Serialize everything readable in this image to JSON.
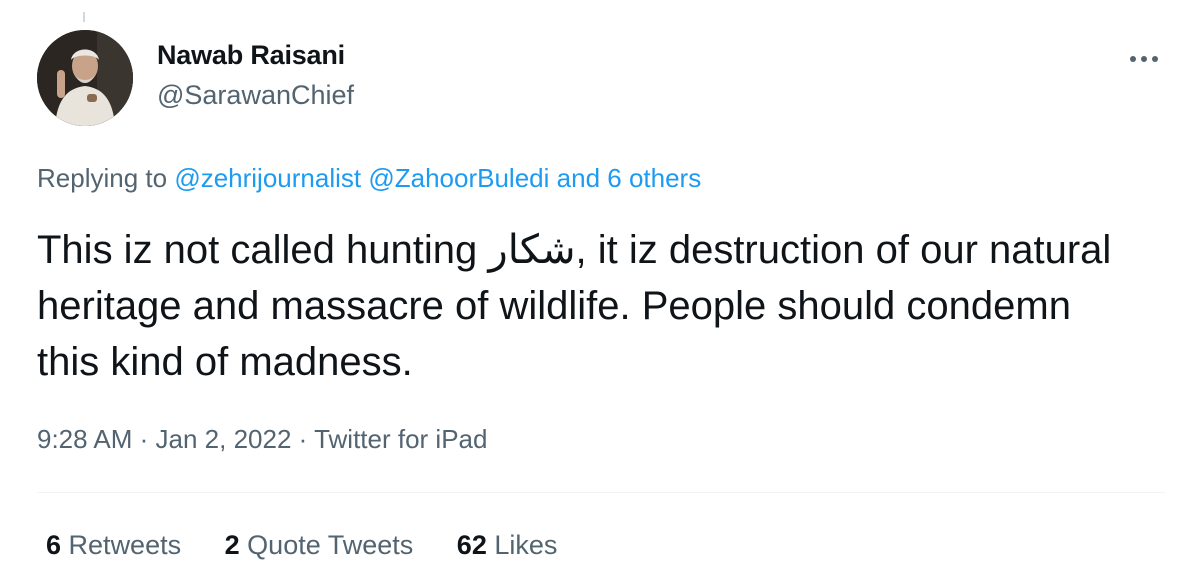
{
  "author": {
    "display_name": "Nawab Raisani",
    "handle": "@SarawanChief"
  },
  "reply": {
    "prefix": "Replying to",
    "mentions": [
      "@zehrijournalist",
      "@ZahoorBuledi"
    ],
    "others": "and 6 others"
  },
  "tweet": {
    "text_part1": "This iz not called hunting ",
    "urdu_word": "شکار",
    "text_part2": ", it iz destruction of our natural heritage and massacre of wildlife. People should condemn this kind of madness."
  },
  "meta": {
    "time": "9:28 AM",
    "date": "Jan 2, 2022",
    "source": "Twitter for iPad"
  },
  "stats": {
    "retweets_count": "6",
    "retweets_label": "Retweets",
    "quotes_count": "2",
    "quotes_label": "Quote Tweets",
    "likes_count": "62",
    "likes_label": "Likes"
  },
  "icons": {
    "more": "more-horizontal-icon"
  },
  "colors": {
    "link": "#1d9bf0",
    "secondary_text": "#536471",
    "primary_text": "#0f1419"
  }
}
